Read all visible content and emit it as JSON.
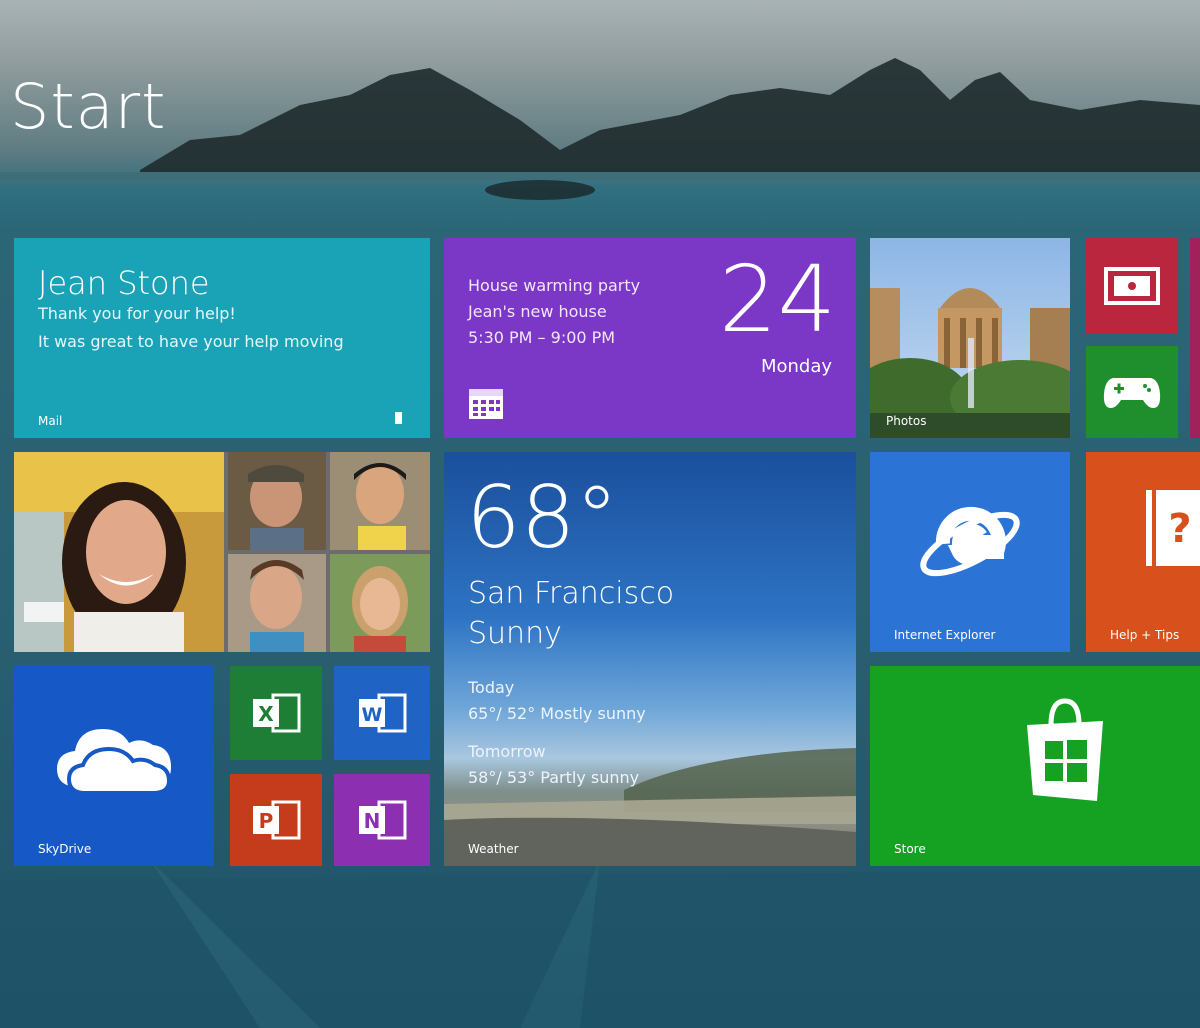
{
  "start": {
    "title": "Start"
  },
  "tiles": {
    "mail": {
      "from": "Jean Stone",
      "line1": "Thank you for your help!",
      "line2": "It was great to have your help moving",
      "label": "Mail"
    },
    "calendar": {
      "event_title": "House warming party",
      "event_location": "Jean's new house",
      "event_time": "5:30 PM – 9:00 PM",
      "day": "24",
      "weekday": "Monday"
    },
    "photos": {
      "label": "Photos"
    },
    "weather": {
      "temperature": "68°",
      "city": "San Francisco",
      "condition": "Sunny",
      "today_label": "Today",
      "today_forecast": "65°/ 52° Mostly sunny",
      "tomorrow_label": "Tomorrow",
      "tomorrow_forecast": "58°/ 53° Partly sunny",
      "label": "Weather"
    },
    "internet_explorer": {
      "label": "Internet Explorer"
    },
    "help": {
      "label": "Help + Tips"
    },
    "skydrive": {
      "label": "SkyDrive"
    },
    "excel": {
      "icon": "excel-icon"
    },
    "word": {
      "icon": "word-icon"
    },
    "powerpoint": {
      "icon": "powerpoint-icon"
    },
    "onenote": {
      "icon": "onenote-icon"
    },
    "store": {
      "label": "Store"
    }
  },
  "colors": {
    "mail": "#1aa2b7",
    "calendar": "#7b37c6",
    "video": "#b9263d",
    "games": "#1f8f2e",
    "internet_explorer": "#2b74d6",
    "help": "#d8501b",
    "skydrive": "#1758c7",
    "store": "#15a122"
  }
}
